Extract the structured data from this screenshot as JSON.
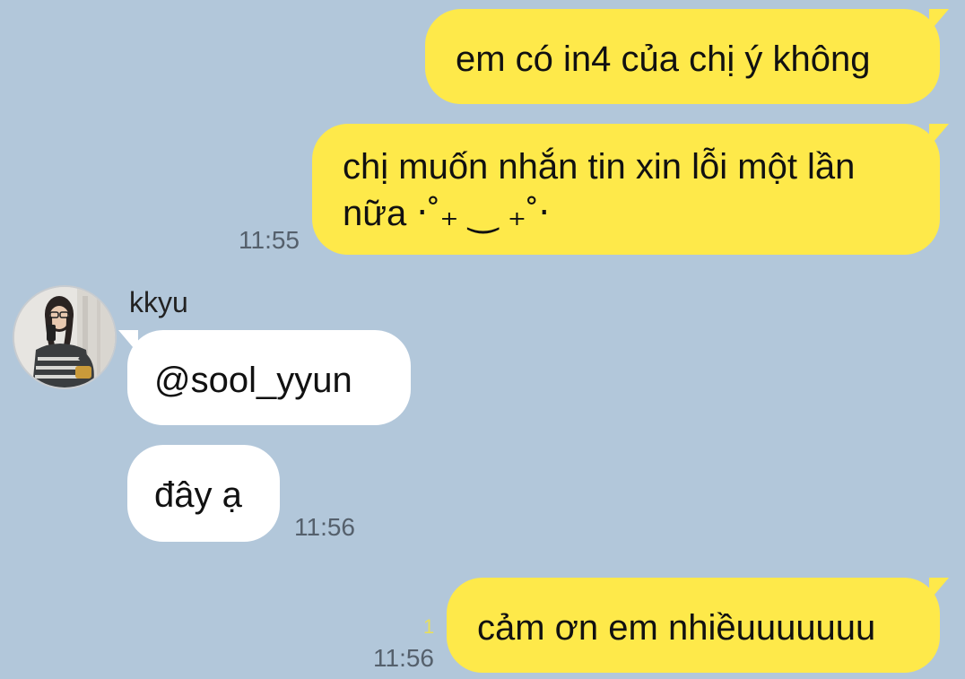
{
  "messages": {
    "m1": {
      "text": "em có in4 của chị ý không"
    },
    "m2": {
      "line1": "chị muốn nhắn tin xin lỗi một lần",
      "line2": "nữa ‧˚₊ ‿ ₊˚‧",
      "time": "11:55"
    },
    "sender": {
      "name": "kkyu"
    },
    "m3": {
      "text": "@sool_yyun"
    },
    "m4": {
      "text": "đây ạ",
      "time": "11:56"
    },
    "m5": {
      "text": "cảm ơn em nhiềuuuuuuu",
      "time": "11:56",
      "unread": "1"
    }
  },
  "colors": {
    "background": "#b2c7da",
    "outgoing_bubble": "#fee94a",
    "incoming_bubble": "#ffffff"
  },
  "icons": {
    "avatar": "profile-photo"
  }
}
